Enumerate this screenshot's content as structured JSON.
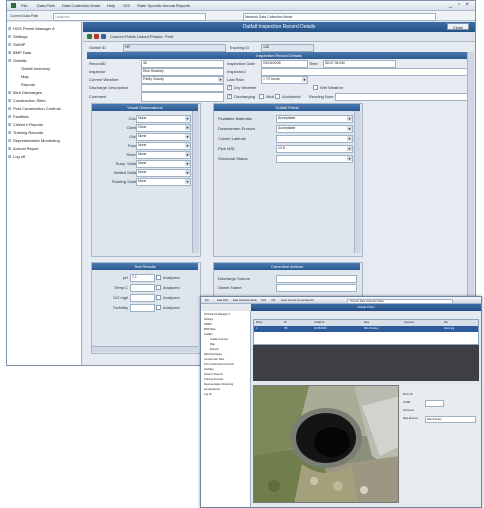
{
  "menubar": {
    "items": [
      "File",
      "Data Path",
      "Data Collection Mode",
      "Help",
      "GIS",
      "State Specific Annual Reports"
    ],
    "controls": "_ ▫ ×"
  },
  "subbar": {
    "data_path_label": "Current Data Path",
    "data_path_value": "Database",
    "mode_value": "Network Data Collection Mode"
  },
  "tree": {
    "items": [
      {
        "label": "HGS Permit Manager 6",
        "indent": 0
      },
      {
        "label": "Settings",
        "indent": 0
      },
      {
        "label": "SWMP",
        "indent": 0
      },
      {
        "label": "BMP Data",
        "indent": 0
      },
      {
        "label": "Outfalls",
        "indent": 0
      },
      {
        "label": "Outfall Inventory",
        "indent": 2
      },
      {
        "label": "Map",
        "indent": 2
      },
      {
        "label": "Reports",
        "indent": 2
      },
      {
        "label": "Illicit Discharges",
        "indent": 0
      },
      {
        "label": "Construction Sites",
        "indent": 0
      },
      {
        "label": "Post Construction Controls",
        "indent": 0
      },
      {
        "label": "Facilities",
        "indent": 0
      },
      {
        "label": "Citizen's Reports",
        "indent": 0
      },
      {
        "label": "Training Records",
        "indent": 0
      },
      {
        "label": "Representative Monitoring",
        "indent": 0
      },
      {
        "label": "Annual Report",
        "indent": 0
      },
      {
        "label": "Log off",
        "indent": 0
      }
    ]
  },
  "panel": {
    "title": "Outfall Inspection Record Details",
    "close_label": "Close",
    "toolbar": [
      "Custom Fields",
      "Linked Photos",
      "Print"
    ],
    "outfall_id_label": "Outfall ID",
    "outfall_id_value": "HR",
    "tracking_id_label": "Tracking ID",
    "tracking_id_value": "128",
    "inspection_header": "Inspection Record Details",
    "record_id_label": "RecordID",
    "record_id_value": "46",
    "inspection_date_label": "Inspection Date",
    "inspection_date_value": "03/15/2008",
    "time_label": "Time",
    "time_value": "08:07:35 AM",
    "inspector_label": "Inspector",
    "inspector_value": "Rick Sharkey",
    "inspector2_label": "Inspector2",
    "inspector2_value": "",
    "current_weather_label": "Current Weather",
    "current_weather_value": "Partly Cloudy",
    "last_rain_label": "Last Rain",
    "last_rain_value": "> 72 hours",
    "discharge_desc_label": "Discharge Description",
    "discharge_desc_value": "",
    "dry_weather_label": "Dry Weather",
    "wet_weather_label": "Wet Weather",
    "comment_label": "Comment",
    "discharging_label": "Discharging",
    "illicit_label": "Illicit",
    "accidental_label": "Accidental",
    "reading_num_label": "Reading Num",
    "visual_header": "Visual Observations",
    "visual_fields": [
      {
        "label": "Color",
        "value": "None"
      },
      {
        "label": "Clarity",
        "value": "Clear"
      },
      {
        "label": "Odor",
        "value": "None"
      },
      {
        "label": "Foam",
        "value": "None"
      },
      {
        "label": "Sheen",
        "value": "None"
      },
      {
        "label": "Susp. Solids",
        "value": "None"
      },
      {
        "label": "Settled Solids",
        "value": "None"
      },
      {
        "label": "Floating Solids",
        "value": "None"
      }
    ],
    "outfall_header": "Outfall Fields",
    "outfall_fields": [
      {
        "label": "Floatable Materials",
        "value": "Acceptable"
      },
      {
        "label": "Downstream Erosion",
        "value": "Acceptable"
      },
      {
        "label": "Culvert Latitude",
        "value": ""
      },
      {
        "label": "Pipe MSL",
        "value": "12.5"
      },
      {
        "label": "Structural Status",
        "value": ""
      }
    ],
    "test_header": "Test Results",
    "test_fields": [
      {
        "label": "pH",
        "value": "7.1",
        "analyzed": "Analyzed"
      },
      {
        "label": "Temp C",
        "value": "",
        "analyzed": "Analyzed"
      },
      {
        "label": "DO mg/l",
        "value": "",
        "analyzed": "Analyzed"
      },
      {
        "label": "Turbidity",
        "value": "",
        "analyzed": "Analyzed"
      }
    ],
    "corrective_header": "Corrective Actions",
    "discharge_source_label": "Discharge Source",
    "owner_name_label": "Owner Name"
  },
  "window2": {
    "title": "Outfall Photo",
    "address_label": "Network Data Collection Mode",
    "grid_headers": [
      "Photo",
      "ID",
      "Outfall ID",
      "Date",
      "Inspector",
      "File"
    ],
    "grid_row": [
      "1",
      "HR",
      "03/15/2008",
      "Rick Sharkey",
      "...",
      "photo.jpg"
    ],
    "side_labels": [
      "Photo ID",
      "Outfall",
      "Comment",
      "Date Entered"
    ],
    "side_value": "Rick Sharkey"
  }
}
